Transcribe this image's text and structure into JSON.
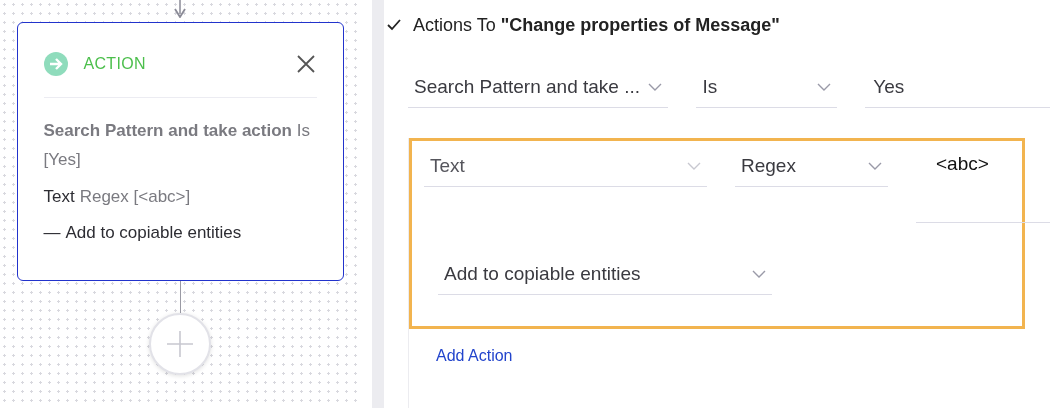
{
  "flow": {
    "node": {
      "kind": "action",
      "selected": true,
      "label": "ACTION",
      "summary": "**Search Pattern and take action** Is [Yes]",
      "lines": [
        {
          "field": "Text",
          "condition": "Regex [<abc>]"
        }
      ],
      "actions": [
        {
          "marker": "—",
          "text": "Add to copiable entities"
        }
      ]
    }
  },
  "panel": {
    "header": {
      "expanded": true,
      "title": "Actions To **\"Change properties of Message\"**"
    },
    "condition": {
      "field": "Search Pattern and take ...",
      "operator": "Is",
      "value": "Yes"
    },
    "actions": [
      {
        "highlighted": true,
        "field": "Text",
        "operator": "Regex",
        "value": "<abc>",
        "action": "Add to copiable entities"
      }
    ],
    "add_action": "Add Action"
  }
}
